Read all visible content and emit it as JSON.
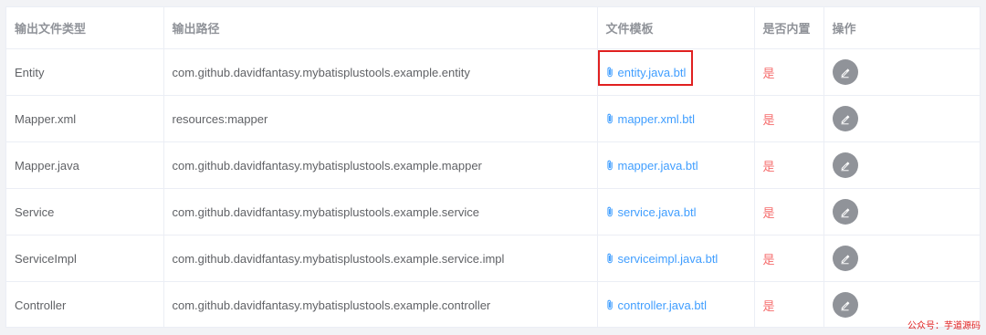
{
  "columns": {
    "type": "输出文件类型",
    "path": "输出路径",
    "template": "文件模板",
    "builtin": "是否内置",
    "action": "操作"
  },
  "rows": [
    {
      "type": "Entity",
      "path": "com.github.davidfantasy.mybatisplustools.example.entity",
      "template": "entity.java.btl",
      "builtin": "是"
    },
    {
      "type": "Mapper.xml",
      "path": "resources:mapper",
      "template": "mapper.xml.btl",
      "builtin": "是"
    },
    {
      "type": "Mapper.java",
      "path": "com.github.davidfantasy.mybatisplustools.example.mapper",
      "template": "mapper.java.btl",
      "builtin": "是"
    },
    {
      "type": "Service",
      "path": "com.github.davidfantasy.mybatisplustools.example.service",
      "template": "service.java.btl",
      "builtin": "是"
    },
    {
      "type": "ServiceImpl",
      "path": "com.github.davidfantasy.mybatisplustools.example.service.impl",
      "template": "serviceimpl.java.btl",
      "builtin": "是"
    },
    {
      "type": "Controller",
      "path": "com.github.davidfantasy.mybatisplustools.example.controller",
      "template": "controller.java.btl",
      "builtin": "是"
    }
  ],
  "icons": {
    "template": "paperclip-icon",
    "action": "edit-icon"
  },
  "colors": {
    "link": "#409eff",
    "builtin": "#f56c6c",
    "action_button": "#909399",
    "highlight": "#e02020"
  },
  "watermark": "公众号：芋道源码"
}
